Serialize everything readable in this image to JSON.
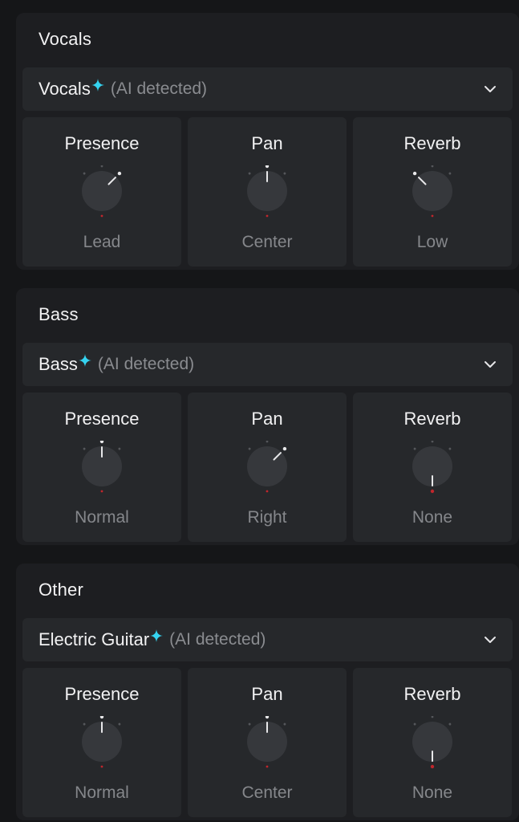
{
  "colors": {
    "accent": "#35d3f0",
    "knob_fill": "#36383c",
    "indicator": "#e8e8ea",
    "tick": "#55575b",
    "red_tick": "#c0262c"
  },
  "ai_tag": "(AI detected)",
  "sections": [
    {
      "title": "Vocals",
      "dropdown_value": "Vocals",
      "knobs": [
        {
          "label": "Presence",
          "value": "Lead",
          "level": 1.0
        },
        {
          "label": "Pan",
          "value": "Center",
          "level": 0.5
        },
        {
          "label": "Reverb",
          "value": "Low",
          "level": 0.0
        }
      ]
    },
    {
      "title": "Bass",
      "dropdown_value": "Bass",
      "knobs": [
        {
          "label": "Presence",
          "value": "Normal",
          "level": 0.5
        },
        {
          "label": "Pan",
          "value": "Right",
          "level": 1.0
        },
        {
          "label": "Reverb",
          "value": "None",
          "level": null
        }
      ]
    },
    {
      "title": "Other",
      "dropdown_value": "Electric Guitar",
      "knobs": [
        {
          "label": "Presence",
          "value": "Normal",
          "level": 0.5
        },
        {
          "label": "Pan",
          "value": "Center",
          "level": 0.5
        },
        {
          "label": "Reverb",
          "value": "None",
          "level": null
        }
      ]
    }
  ]
}
